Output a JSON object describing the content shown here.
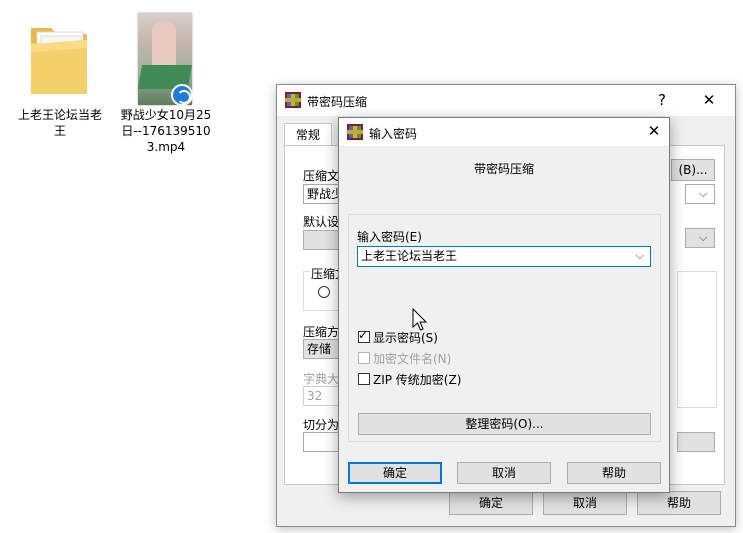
{
  "desktop": {
    "folder_label": "上老王论坛当老王",
    "video_label": "野战少女10月25日--1761395103.mp4"
  },
  "back_dialog": {
    "title": "带密码压缩",
    "help_btn": "?",
    "close_btn": "✕",
    "tab_general": "常规",
    "archive_name_label": "压缩文",
    "archive_name_value": "野战少",
    "browse_button": "(B)...",
    "default_profile_label": "默认设",
    "compression_format_label": "压缩文",
    "method_label": "压缩方",
    "method_value": "存储",
    "dict_label": "字典大",
    "dict_value": "32",
    "split_label": "切分为",
    "ok": "确定",
    "cancel": "取消",
    "help": "帮助"
  },
  "front_dialog": {
    "title": "输入密码",
    "close_btn": "✕",
    "heading": "带密码压缩",
    "password_label": "输入密码(E)",
    "password_value": "上老王论坛当老王",
    "show_password": "显示密码(S)",
    "show_password_checked": true,
    "encrypt_filenames": "加密文件名(N)",
    "encrypt_filenames_checked": false,
    "encrypt_filenames_disabled": true,
    "zip_legacy": "ZIP 传统加密(Z)",
    "zip_legacy_checked": false,
    "organize_button": "整理密码(O)...",
    "ok": "确定",
    "cancel": "取消",
    "help": "帮助"
  },
  "icons": [
    "folder-icon",
    "video-thumbnail",
    "app-winrar-icon",
    "chevron-down-icon",
    "checkmark-icon",
    "mouse-cursor-icon"
  ]
}
